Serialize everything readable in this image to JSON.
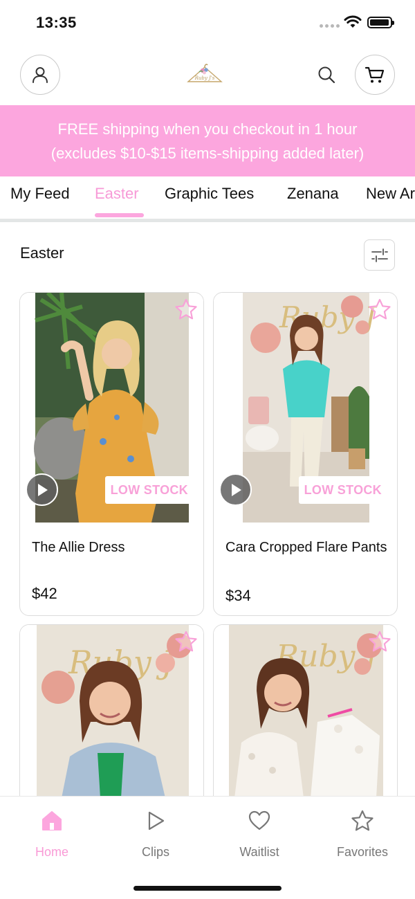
{
  "status_bar": {
    "time": "13:35"
  },
  "header": {
    "account_icon": "person-icon",
    "logo_icon": "hanger-logo-icon",
    "search_icon": "search-icon",
    "cart_icon": "cart-icon"
  },
  "banner": {
    "line1": "FREE shipping when you checkout in 1 hour",
    "line2": "(excludes $10-$15 items-shipping added later)"
  },
  "tabs": [
    {
      "label": "My Feed",
      "active": false
    },
    {
      "label": "Easter",
      "active": true
    },
    {
      "label": "Graphic Tees",
      "active": false
    },
    {
      "label": "Zenana",
      "active": false
    },
    {
      "label": "New Ar",
      "active": false
    }
  ],
  "section": {
    "title": "Easter",
    "filter_icon": "sliders-icon"
  },
  "products": [
    {
      "name": "The Allie Dress",
      "price": "$42",
      "badge": "LOW STOCK",
      "has_video": true
    },
    {
      "name": "Cara Cropped Flare Pants",
      "price": "$34",
      "badge": "LOW STOCK",
      "has_video": true
    },
    {
      "name": "",
      "price": "",
      "badge": "",
      "has_video": false
    },
    {
      "name": "",
      "price": "",
      "badge": "",
      "has_video": false
    }
  ],
  "bottom_nav": [
    {
      "label": "Home",
      "icon": "home-icon",
      "active": true
    },
    {
      "label": "Clips",
      "icon": "play-outline-icon",
      "active": false
    },
    {
      "label": "Waitlist",
      "icon": "heart-icon",
      "active": false
    },
    {
      "label": "Favorites",
      "icon": "star-icon",
      "active": false
    }
  ],
  "colors": {
    "accent": "#fca6de",
    "accent_text": "#f79ad7",
    "divider": "#e3e6e6"
  }
}
